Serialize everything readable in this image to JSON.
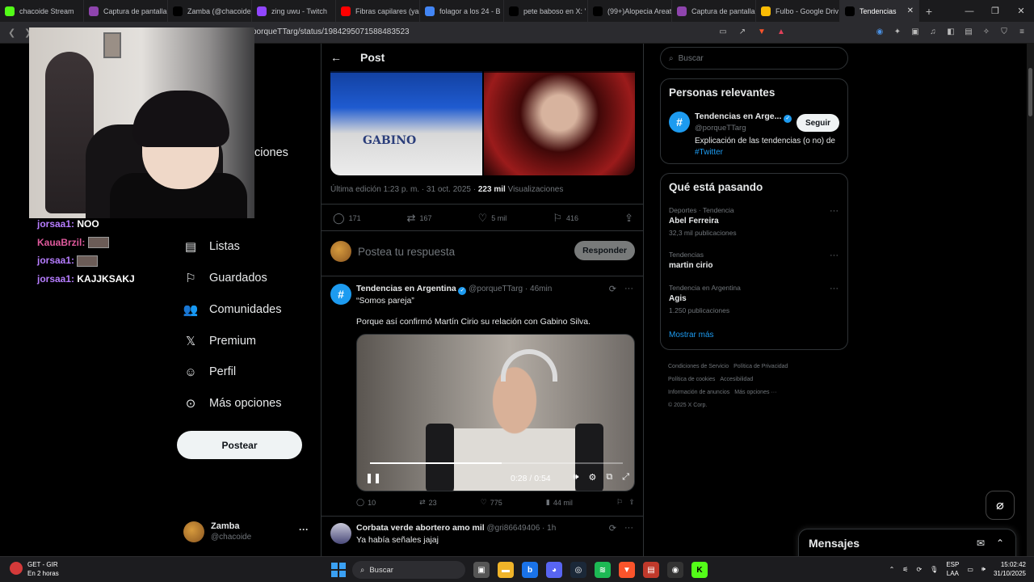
{
  "browser": {
    "tabs": [
      {
        "label": "chacoide Stream",
        "color": "#53fc18"
      },
      {
        "label": "Captura de pantalla",
        "color": "#8e44ad"
      },
      {
        "label": "Zamba (@chacoide",
        "color": "#000000"
      },
      {
        "label": "zing uwu - Twitch",
        "color": "#9146ff"
      },
      {
        "label": "Fibras capilares (ya",
        "color": "#ff0000"
      },
      {
        "label": "folagor a los 24 - B",
        "color": "#4285f4"
      },
      {
        "label": "pete baboso en X: '",
        "color": "#000000"
      },
      {
        "label": "(99+)Alopecia Areat",
        "color": "#000000"
      },
      {
        "label": "Captura de pantalla",
        "color": "#8e44ad"
      },
      {
        "label": "Fulbo - Google Driv",
        "color": "#fbbc04"
      },
      {
        "label": "Tendencias",
        "color": "#000000"
      }
    ],
    "url": "porqueTTarg/status/1984295071588483523"
  },
  "stream": {
    "chat": [
      {
        "user": "jorsaa1:",
        "msg": "NOO",
        "emote": false
      },
      {
        "user": "KauaBrzil:",
        "msg": "",
        "emote": true
      },
      {
        "user": "jorsaa1:",
        "msg": "",
        "emote": true
      },
      {
        "user": "jorsaa1:",
        "msg": "KAJJKSAKJ",
        "emote": false
      }
    ],
    "partial_nav_text": "ciones"
  },
  "nav": {
    "items": [
      {
        "label": "Listas",
        "icon": "list-icon"
      },
      {
        "label": "Guardados",
        "icon": "bookmark-icon"
      },
      {
        "label": "Comunidades",
        "icon": "communities-icon"
      },
      {
        "label": "Premium",
        "icon": "x-logo-icon"
      },
      {
        "label": "Perfil",
        "icon": "profile-icon"
      },
      {
        "label": "Más opciones",
        "icon": "more-icon"
      }
    ],
    "post_button": "Postear",
    "account": {
      "name": "Zamba",
      "handle": "@chacoide",
      "more": "···"
    }
  },
  "post": {
    "header_title": "Post",
    "image_text": "GABINO",
    "meta_prefix": "Última edición 1:23 p. m. · 31 oct. 2025 · ",
    "views_count": "223 mil",
    "views_label": " Visualizaciones",
    "stats": {
      "replies": "171",
      "reposts": "167",
      "likes": "5 mil",
      "bookmarks": "416"
    },
    "reply_placeholder": "Postea tu respuesta",
    "reply_button": "Responder"
  },
  "tweets": [
    {
      "name": "Tendencias en Argentina",
      "handle": "@porqueTTarg",
      "time": "46min",
      "line1": "“Somos pareja”",
      "line2": "Porque así confirmó Martín Cirio su relación con Gabino Silva.",
      "video": {
        "time": "0:28 / 0:54",
        "progress": 0.52
      },
      "stats": {
        "replies": "10",
        "reposts": "23",
        "likes": "775",
        "views": "44 mil"
      }
    },
    {
      "name": "Corbata verde abortero amo mil",
      "handle": "@gri86649406",
      "time": "1h",
      "line1": "Ya había señales jajaj"
    }
  ],
  "right": {
    "search_placeholder": "Buscar",
    "relevant_title": "Personas relevantes",
    "relevant": {
      "name": "Tendencias en Arge...",
      "handle": "@porqueTTarg",
      "follow": "Seguir",
      "bio": "Explicación de las tendencias (o no) de",
      "hashtag": "#Twitter"
    },
    "trends_title": "Qué está pasando",
    "trends": [
      {
        "category": "Deportes · Tendencia",
        "name": "Abel Ferreira",
        "count": "32,3 mil publicaciones"
      },
      {
        "category": "Tendencias",
        "name": "martin cirio",
        "count": ""
      },
      {
        "category": "Tendencia en Argentina",
        "name": "Agis",
        "count": "1.250 publicaciones"
      }
    ],
    "show_more": "Mostrar más",
    "footer": [
      "Condiciones de Servicio",
      "Política de Privacidad",
      "Política de cookies",
      "Accesibilidad",
      "Información de anuncios",
      "Más opciones ···",
      "© 2025 X Corp."
    ],
    "messages_title": "Mensajes"
  },
  "taskbar": {
    "weather_line1": "GET - GIR",
    "weather_line2": "En 2 horas",
    "search": "Buscar",
    "lang1": "ESP",
    "lang2": "LAA",
    "time": "15:02:42",
    "date": "31/10/2025"
  }
}
